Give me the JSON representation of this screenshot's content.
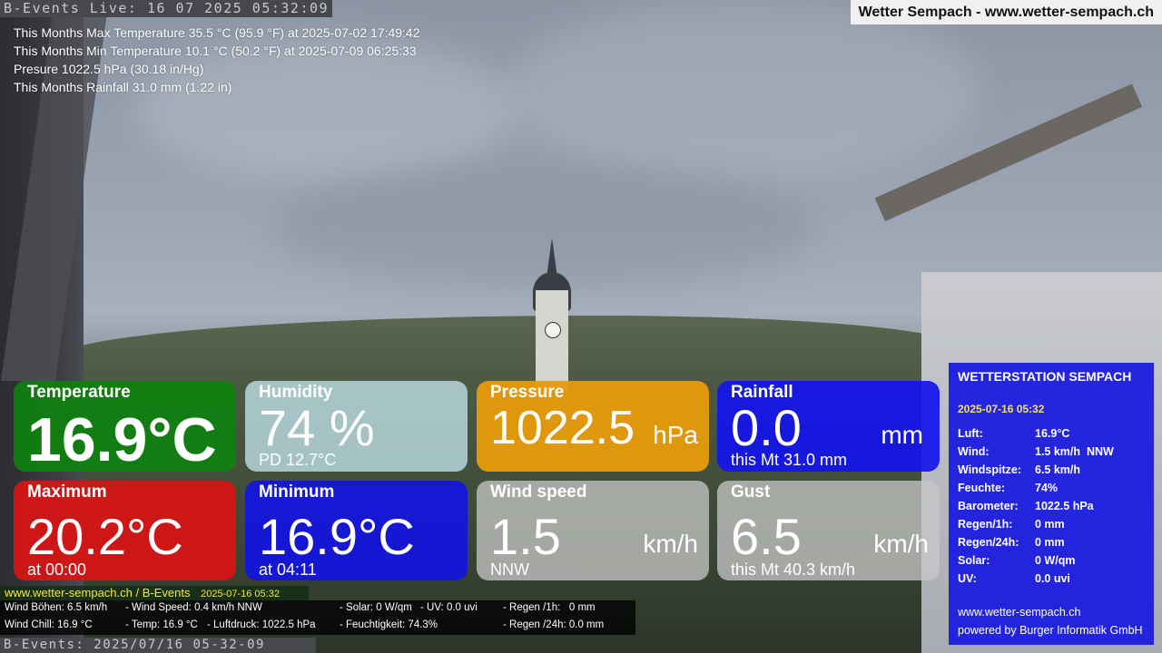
{
  "live_bar": "B-Events Live: 16 07 2025 05:32:09",
  "site_banner": "Wetter Sempach - www.wetter-sempach.ch",
  "stats": {
    "max_temp": "This Months Max Temperature 35.5 °C (95.9 °F) at 2025-07-02 17:49:42",
    "min_temp": "This Months Min Temperature 10.1 °C (50.2 °F) at 2025-07-09 06:25:33",
    "pressure": "Presure 1022.5 hPa (30.18 in/Hg)",
    "rainfall": "This Months Rainfall 31.0 mm (1.22 in)"
  },
  "tiles": {
    "temperature": {
      "title": "Temperature",
      "value": "16.9°C",
      "color": "#108010"
    },
    "humidity": {
      "title": "Humidity",
      "value": "74 %",
      "sub": "PD 12.7°C",
      "color": "#bedee6"
    },
    "pressure": {
      "title": "Pressure",
      "value": "1022.5",
      "unit": "hPa",
      "color": "#e89b0a"
    },
    "rainfall": {
      "title": "Rainfall",
      "value": "0.0",
      "unit": "mm",
      "sub": "this Mt 31.0 mm",
      "color": "#1414eb"
    },
    "maximum": {
      "title": "Maximum",
      "value": "20.2°C",
      "sub": "at 00:00",
      "color": "#da1414"
    },
    "minimum": {
      "title": "Minimum",
      "value": "16.9°C",
      "sub": "at 04:11",
      "color": "#1414e1"
    },
    "wind": {
      "title": "Wind speed",
      "value": "1.5",
      "unit": "km/h",
      "sub": "NNW",
      "color": "#c8c8c8"
    },
    "gust": {
      "title": "Gust",
      "value": "6.5",
      "unit": "km/h",
      "sub": "this Mt 40.3 km/h",
      "color": "#c8c8c8"
    }
  },
  "panel": {
    "title": "WETTERSTATION SEMPACH",
    "date": "2025-07-16 05:32",
    "rows": [
      {
        "key": "Luft:",
        "value": "16.9°C"
      },
      {
        "key": "Wind:",
        "value": "1.5 km/h  NNW"
      },
      {
        "key": "Windspitze:",
        "value": "6.5 km/h"
      },
      {
        "key": "Feuchte:",
        "value": "74%"
      },
      {
        "key": "Barometer:",
        "value": "1022.5 hPa"
      },
      {
        "key": "Regen/1h:",
        "value": "0 mm"
      },
      {
        "key": "Regen/24h:",
        "value": "0 mm"
      },
      {
        "key": "Solar:",
        "value": "0 W/qm"
      },
      {
        "key": "UV:",
        "value": "0.0 uvi"
      }
    ],
    "footer_url": "www.wetter-sempach.ch",
    "footer_credit": "powered by Burger Informatik GmbH",
    "color": "#1818e1"
  },
  "ticker": {
    "header_url": "www.wetter-sempach.ch / B-Events",
    "header_time": "2025-07-16 05:32",
    "line1": {
      "a": "Wind Böhen: 6.5 km/h",
      "b": "- Wind Speed: 0.4 km/h NNW",
      "c": "- Solar: 0 W/qm",
      "d": "- UV: 0.0 uvi",
      "e": "- Regen /1h:   0 mm"
    },
    "line2": {
      "a": "Wind Chill: 16.9 °C",
      "b": "- Temp: 16.9 °C",
      "c": "- Luftdruck: 1022.5 hPa",
      "d": "- Feuchtigkeit: 74.3%",
      "e": "- Regen /24h: 0.0 mm"
    }
  },
  "bottom_bar": "B-Events: 2025/07/16 05-32-09"
}
